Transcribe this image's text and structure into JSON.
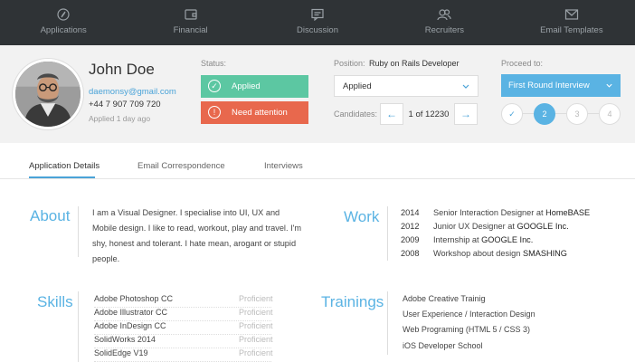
{
  "nav": [
    {
      "label": "Applications",
      "icon": "compass-icon"
    },
    {
      "label": "Financial",
      "icon": "wallet-icon"
    },
    {
      "label": "Discussion",
      "icon": "chat-icon"
    },
    {
      "label": "Recruiters",
      "icon": "users-icon"
    },
    {
      "label": "Email Templates",
      "icon": "envelope-icon"
    }
  ],
  "profile": {
    "name": "John Doe",
    "email": "daemonsy@gmail.com",
    "phone": "+44 7 907 709 720",
    "applied_ago": "Applied 1 day ago"
  },
  "status": {
    "label": "Status:",
    "applied": "Applied",
    "attention": "Need attention"
  },
  "position": {
    "label": "Position:",
    "value": "Ruby on Rails Developer",
    "select_value": "Applied"
  },
  "candidates": {
    "label": "Candidates:",
    "pager": "1 of 12230"
  },
  "proceed": {
    "label": "Proceed to:",
    "button": "First Round Interview",
    "steps": [
      "✓",
      "2",
      "3",
      "4"
    ],
    "current_step": 2
  },
  "tabs": [
    "Application Details",
    "Email Correspondence",
    "Interviews"
  ],
  "about": {
    "title": "About",
    "text": "I am a Visual Designer. I specialise into UI, UX and Mobile design. I like to read, workout, play and travel. I'm shy, honest and tolerant. I hate mean, arogant or stupid people."
  },
  "work": {
    "title": "Work",
    "items": [
      {
        "year": "2014",
        "role": "Senior Interaction Designer at",
        "company": "HomeBASE"
      },
      {
        "year": "2012",
        "role": "Junior UX Designer at",
        "company": "GOOGLE Inc."
      },
      {
        "year": "2009",
        "role": "Internship at",
        "company": "GOOGLE Inc."
      },
      {
        "year": "2008",
        "role": "Workshop about design",
        "company": "SMASHING"
      }
    ]
  },
  "skills": {
    "title": "Skills",
    "items": [
      {
        "name": "Adobe Photoshop CC",
        "level": "Proficient"
      },
      {
        "name": "Adobe Illustrator CC",
        "level": "Proficient"
      },
      {
        "name": "Adobe InDesign CC",
        "level": "Proficient"
      },
      {
        "name": "SolidWorks 2014",
        "level": "Proficient"
      },
      {
        "name": "SolidEdge V19",
        "level": "Proficient"
      }
    ]
  },
  "trainings": {
    "title": "Trainings",
    "items": [
      "Adobe Creative Trainig",
      "User Experience / Interaction Design",
      "Web Programing (HTML 5 / CSS 3)",
      "iOS Developer School"
    ]
  },
  "colors": {
    "accent": "#5ab3e3",
    "success": "#5cc7a2",
    "danger": "#e8684d",
    "nav_bg": "#2f3336"
  }
}
